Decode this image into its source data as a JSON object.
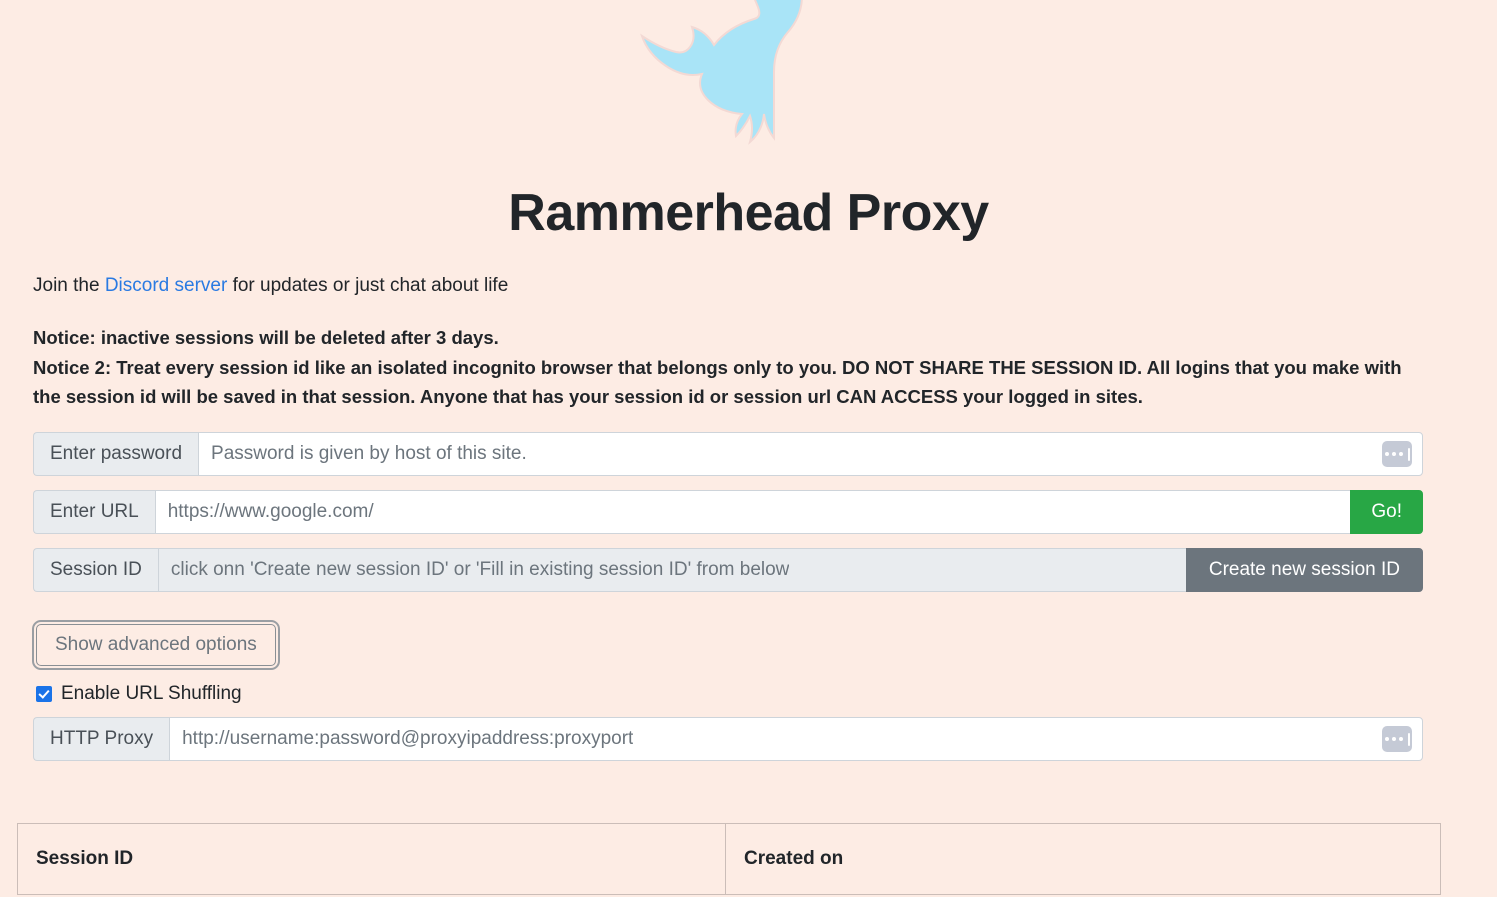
{
  "branding": {
    "logo_icon": "hammerhead-shark-logo",
    "logo_color": "#a9e4f7",
    "title": "Rammerhead Proxy",
    "title_color": "#212529",
    "background_color": "#fdece4"
  },
  "intro": {
    "before_link": "Join the ",
    "link_text": "Discord server",
    "link_color": "#2a7ae2",
    "after_link": " for updates or just chat about life"
  },
  "notices": [
    "Notice: inactive sessions will be deleted after 3 days.",
    "Notice 2: Treat every session id like an isolated incognito browser that belongs only to you. DO NOT SHARE THE SESSION ID. All logins that you make with the session id will be saved in that session. Anyone that has your session id or session url CAN ACCESS your logged in sites."
  ],
  "form": {
    "password": {
      "label": "Enter password",
      "value": "",
      "placeholder": "Password is given by host of this site.",
      "icon": "password-manager-icon"
    },
    "url": {
      "label": "Enter URL",
      "value": "",
      "placeholder": "https://www.google.com/",
      "submit_label": "Go!",
      "submit_color": "#28a745"
    },
    "session": {
      "label": "Session ID",
      "value": "",
      "placeholder": "click onn 'Create new session ID' or 'Fill in existing session ID' from below",
      "create_label": "Create new session ID",
      "create_color": "#6c757d"
    },
    "advanced_toggle_label": "Show advanced options",
    "shuffling": {
      "label": "Enable URL Shuffling",
      "checked": true,
      "accent_color": "#1a73e8"
    },
    "http_proxy": {
      "label": "HTTP Proxy",
      "value": "",
      "placeholder": "http://username:password@proxyipaddress:proxyport",
      "icon": "password-manager-icon"
    }
  },
  "sessions_table": {
    "columns": [
      "Session ID",
      "Created on"
    ],
    "rows": []
  }
}
